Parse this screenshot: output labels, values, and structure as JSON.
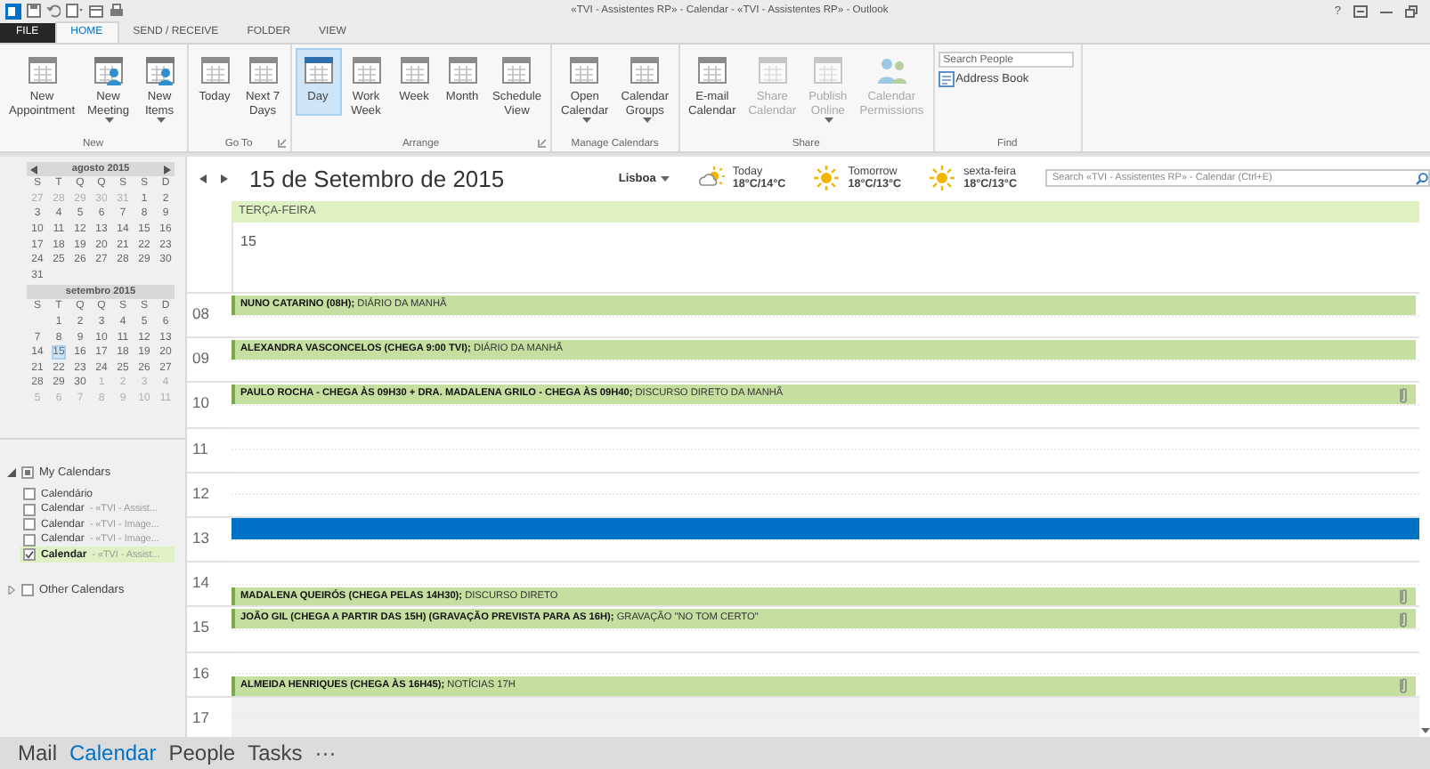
{
  "window": {
    "title": "«TVI - Assistentes RP» - Calendar - «TVI - Assistentes RP» - Outlook",
    "help": "?"
  },
  "ribbon_tabs": [
    {
      "label": "FILE",
      "kind": "file",
      "selected": false
    },
    {
      "label": "HOME",
      "kind": "tab",
      "selected": true
    },
    {
      "label": "SEND / RECEIVE",
      "kind": "tab",
      "selected": false
    },
    {
      "label": "FOLDER",
      "kind": "tab",
      "selected": false
    },
    {
      "label": "VIEW",
      "kind": "tab",
      "selected": false
    }
  ],
  "ribbon_groups": [
    {
      "label": "New",
      "kind": "buttons",
      "launcher": false,
      "buttons": [
        {
          "lines": [
            "New",
            "Appointment"
          ],
          "dropdown": false,
          "disabled": false,
          "selected": false
        },
        {
          "lines": [
            "New",
            "Meeting"
          ],
          "dropdown": true,
          "disabled": false,
          "selected": false
        },
        {
          "lines": [
            "New",
            "Items"
          ],
          "dropdown": true,
          "disabled": false,
          "selected": false
        }
      ]
    },
    {
      "label": "Go To",
      "kind": "buttons",
      "launcher": true,
      "buttons": [
        {
          "lines": [
            "Today"
          ],
          "dropdown": false,
          "disabled": false,
          "selected": false
        },
        {
          "lines": [
            "Next 7",
            "Days"
          ],
          "dropdown": false,
          "disabled": false,
          "selected": false
        }
      ]
    },
    {
      "label": "Arrange",
      "kind": "buttons",
      "launcher": true,
      "buttons": [
        {
          "lines": [
            "Day"
          ],
          "dropdown": false,
          "disabled": false,
          "selected": true
        },
        {
          "lines": [
            "Work",
            "Week"
          ],
          "dropdown": false,
          "disabled": false,
          "selected": false
        },
        {
          "lines": [
            "Week"
          ],
          "dropdown": false,
          "disabled": false,
          "selected": false
        },
        {
          "lines": [
            "Month"
          ],
          "dropdown": false,
          "disabled": false,
          "selected": false
        },
        {
          "lines": [
            "Schedule",
            "View"
          ],
          "dropdown": false,
          "disabled": false,
          "selected": false
        }
      ]
    },
    {
      "label": "Manage Calendars",
      "kind": "buttons",
      "launcher": false,
      "buttons": [
        {
          "lines": [
            "Open",
            "Calendar"
          ],
          "dropdown": true,
          "disabled": false,
          "selected": false
        },
        {
          "lines": [
            "Calendar",
            "Groups"
          ],
          "dropdown": true,
          "disabled": false,
          "selected": false
        }
      ]
    },
    {
      "label": "Share",
      "kind": "buttons",
      "launcher": false,
      "buttons": [
        {
          "lines": [
            "E-mail",
            "Calendar"
          ],
          "dropdown": false,
          "disabled": false,
          "selected": false
        },
        {
          "lines": [
            "Share",
            "Calendar"
          ],
          "dropdown": false,
          "disabled": true,
          "selected": false
        },
        {
          "lines": [
            "Publish",
            "Online"
          ],
          "dropdown": true,
          "disabled": true,
          "selected": false
        },
        {
          "lines": [
            "Calendar",
            "Permissions"
          ],
          "dropdown": false,
          "disabled": true,
          "selected": false
        }
      ]
    },
    {
      "label": "Find",
      "kind": "find",
      "launcher": false,
      "search_placeholder": "Search People",
      "address_book": "Address Book"
    }
  ],
  "mini_calendars": [
    {
      "month": "agosto 2015",
      "arrows": true,
      "weekdays": [
        "S",
        "T",
        "Q",
        "Q",
        "S",
        "S",
        "D"
      ],
      "weeks": [
        [
          {
            "day": "27",
            "other_month": true,
            "selected": false
          },
          {
            "day": "28",
            "other_month": true,
            "selected": false
          },
          {
            "day": "29",
            "other_month": true,
            "selected": false
          },
          {
            "day": "30",
            "other_month": true,
            "selected": false
          },
          {
            "day": "31",
            "other_month": true,
            "selected": false
          },
          {
            "day": "1",
            "other_month": false,
            "selected": false
          },
          {
            "day": "2",
            "other_month": false,
            "selected": false
          }
        ],
        [
          {
            "day": "3",
            "other_month": false,
            "selected": false
          },
          {
            "day": "4",
            "other_month": false,
            "selected": false
          },
          {
            "day": "5",
            "other_month": false,
            "selected": false
          },
          {
            "day": "6",
            "other_month": false,
            "selected": false
          },
          {
            "day": "7",
            "other_month": false,
            "selected": false
          },
          {
            "day": "8",
            "other_month": false,
            "selected": false
          },
          {
            "day": "9",
            "other_month": false,
            "selected": false
          }
        ],
        [
          {
            "day": "10",
            "other_month": false,
            "selected": false
          },
          {
            "day": "11",
            "other_month": false,
            "selected": false
          },
          {
            "day": "12",
            "other_month": false,
            "selected": false
          },
          {
            "day": "13",
            "other_month": false,
            "selected": false
          },
          {
            "day": "14",
            "other_month": false,
            "selected": false
          },
          {
            "day": "15",
            "other_month": false,
            "selected": false
          },
          {
            "day": "16",
            "other_month": false,
            "selected": false
          }
        ],
        [
          {
            "day": "17",
            "other_month": false,
            "selected": false
          },
          {
            "day": "18",
            "other_month": false,
            "selected": false
          },
          {
            "day": "19",
            "other_month": false,
            "selected": false
          },
          {
            "day": "20",
            "other_month": false,
            "selected": false
          },
          {
            "day": "21",
            "other_month": false,
            "selected": false
          },
          {
            "day": "22",
            "other_month": false,
            "selected": false
          },
          {
            "day": "23",
            "other_month": false,
            "selected": false
          }
        ],
        [
          {
            "day": "24",
            "other_month": false,
            "selected": false
          },
          {
            "day": "25",
            "other_month": false,
            "selected": false
          },
          {
            "day": "26",
            "other_month": false,
            "selected": false
          },
          {
            "day": "27",
            "other_month": false,
            "selected": false
          },
          {
            "day": "28",
            "other_month": false,
            "selected": false
          },
          {
            "day": "29",
            "other_month": false,
            "selected": false
          },
          {
            "day": "30",
            "other_month": false,
            "selected": false
          }
        ],
        [
          {
            "day": "31",
            "other_month": false,
            "selected": false
          }
        ]
      ]
    },
    {
      "month": "setembro 2015",
      "arrows": false,
      "weekdays": [
        "S",
        "T",
        "Q",
        "Q",
        "S",
        "S",
        "D"
      ],
      "weeks": [
        [
          {
            "day": "1",
            "other_month": false,
            "selected": false
          },
          {
            "day": "2",
            "other_month": false,
            "selected": false
          },
          {
            "day": "3",
            "other_month": false,
            "selected": false
          },
          {
            "day": "4",
            "other_month": false,
            "selected": false
          },
          {
            "day": "5",
            "other_month": false,
            "selected": false
          },
          {
            "day": "6",
            "other_month": false,
            "selected": false
          }
        ],
        [
          {
            "day": "7",
            "other_month": false,
            "selected": false
          },
          {
            "day": "8",
            "other_month": false,
            "selected": false
          },
          {
            "day": "9",
            "other_month": false,
            "selected": false
          },
          {
            "day": "10",
            "other_month": false,
            "selected": false
          },
          {
            "day": "11",
            "other_month": false,
            "selected": false
          },
          {
            "day": "12",
            "other_month": false,
            "selected": false
          },
          {
            "day": "13",
            "other_month": false,
            "selected": false
          }
        ],
        [
          {
            "day": "14",
            "other_month": false,
            "selected": false
          },
          {
            "day": "15",
            "other_month": false,
            "selected": true
          },
          {
            "day": "16",
            "other_month": false,
            "selected": false
          },
          {
            "day": "17",
            "other_month": false,
            "selected": false
          },
          {
            "day": "18",
            "other_month": false,
            "selected": false
          },
          {
            "day": "19",
            "other_month": false,
            "selected": false
          },
          {
            "day": "20",
            "other_month": false,
            "selected": false
          }
        ],
        [
          {
            "day": "21",
            "other_month": false,
            "selected": false
          },
          {
            "day": "22",
            "other_month": false,
            "selected": false
          },
          {
            "day": "23",
            "other_month": false,
            "selected": false
          },
          {
            "day": "24",
            "other_month": false,
            "selected": false
          },
          {
            "day": "25",
            "other_month": false,
            "selected": false
          },
          {
            "day": "26",
            "other_month": false,
            "selected": false
          },
          {
            "day": "27",
            "other_month": false,
            "selected": false
          }
        ],
        [
          {
            "day": "28",
            "other_month": false,
            "selected": false
          },
          {
            "day": "29",
            "other_month": false,
            "selected": false
          },
          {
            "day": "30",
            "other_month": false,
            "selected": false
          },
          {
            "day": "1",
            "other_month": true,
            "selected": false
          },
          {
            "day": "2",
            "other_month": true,
            "selected": false
          },
          {
            "day": "3",
            "other_month": true,
            "selected": false
          },
          {
            "day": "4",
            "other_month": true,
            "selected": false
          }
        ],
        [
          {
            "day": "5",
            "other_month": true,
            "selected": false
          },
          {
            "day": "6",
            "other_month": true,
            "selected": false
          },
          {
            "day": "7",
            "other_month": true,
            "selected": false
          },
          {
            "day": "8",
            "other_month": true,
            "selected": false
          },
          {
            "day": "9",
            "other_month": true,
            "selected": false
          },
          {
            "day": "10",
            "other_month": true,
            "selected": false
          },
          {
            "day": "11",
            "other_month": true,
            "selected": false
          }
        ]
      ]
    }
  ],
  "calendar_groups": [
    {
      "label": "My Calendars",
      "expanded": true,
      "checked": true,
      "items": [
        {
          "name": "Calendário",
          "checked": false,
          "selected": false
        },
        {
          "name": "Calendar",
          "owner": "- «TVI - Assist...",
          "checked": false,
          "selected": false
        },
        {
          "name": "Calendar",
          "owner": "- «TVI - Image...",
          "checked": false,
          "selected": false
        },
        {
          "name": "Calendar",
          "owner": "- «TVI - Image...",
          "checked": false,
          "selected": false
        },
        {
          "name": "Calendar",
          "owner": "- «TVI - Assist...",
          "checked": true,
          "selected": true
        }
      ]
    },
    {
      "label": "Other Calendars",
      "expanded": false,
      "checked": false
    }
  ],
  "day_view": {
    "date_title": "15 de Setembro de 2015",
    "location": "Lisboa",
    "weather": [
      {
        "day": "Today",
        "temps": "18°C/14°C",
        "kind": "partly-cloudy"
      },
      {
        "day": "Tomorrow",
        "temps": "18°C/13°C",
        "kind": "sunny"
      },
      {
        "day": "sexta-feira",
        "temps": "18°C/13°C",
        "kind": "sunny"
      }
    ],
    "search_placeholder": "Search «TVI - Assistentes RP» - Calendar (Ctrl+E)",
    "day_header": "TERÇA-FEIRA",
    "day_number": "15",
    "hours": [
      {
        "label": "08",
        "working": true,
        "slots": [
          {
            "selected": false,
            "event": {
              "text": "**NUNO CATARINO (08H);** DIÁRIO DA MANHÃ",
              "attachment": false
            }
          },
          {
            "selected": false
          }
        ]
      },
      {
        "label": "09",
        "working": true,
        "slots": [
          {
            "selected": false,
            "event": {
              "text": "**ALEXANDRA VASCONCELOS (CHEGA 9:00 TVI);** DIÁRIO DA MANHÃ",
              "attachment": false
            }
          },
          {
            "selected": false
          }
        ]
      },
      {
        "label": "10",
        "working": true,
        "slots": [
          {
            "selected": false,
            "event": {
              "text": "**PAULO ROCHA - CHEGA ÀS 09H30 + DRA. MADALENA GRILO - CHEGA ÀS 09H40;** DISCURSO DIRETO DA MANHÃ",
              "attachment": true
            }
          },
          {
            "selected": false
          }
        ]
      },
      {
        "label": "11",
        "working": true,
        "slots": [
          {
            "selected": false
          },
          {
            "selected": false
          }
        ]
      },
      {
        "label": "12",
        "working": true,
        "slots": [
          {
            "selected": false
          },
          {
            "selected": false
          }
        ]
      },
      {
        "label": "13",
        "working": true,
        "slots": [
          {
            "selected": true
          },
          {
            "selected": false
          }
        ]
      },
      {
        "label": "14",
        "working": true,
        "slots": [
          {
            "selected": false
          },
          {
            "selected": false,
            "event": {
              "text": "**MADALENA QUEIRÓS (CHEGA PELAS 14H30);** DISCURSO DIRETO",
              "attachment": true
            }
          }
        ]
      },
      {
        "label": "15",
        "working": true,
        "slots": [
          {
            "selected": false,
            "event": {
              "text": "**JOÃO GIL (CHEGA A PARTIR DAS 15H) (GRAVAÇÃO PREVISTA PARA AS 16H);** GRAVAÇÃO \"NO TOM CERTO\"",
              "attachment": true
            }
          },
          {
            "selected": false
          }
        ]
      },
      {
        "label": "16",
        "working": true,
        "slots": [
          {
            "selected": false
          },
          {
            "selected": false,
            "event": {
              "text": "**ALMEIDA HENRIQUES (CHEGA ÀS 16H45);** NOTÍCIAS 17H",
              "attachment": true
            }
          }
        ]
      },
      {
        "label": "17",
        "working": false,
        "slots": [
          {
            "selected": false
          },
          {
            "selected": false
          }
        ]
      }
    ]
  },
  "bottom_nav": [
    {
      "label": "Mail",
      "selected": false
    },
    {
      "label": "Calendar",
      "selected": true
    },
    {
      "label": "People",
      "selected": false
    },
    {
      "label": "Tasks",
      "selected": false
    },
    {
      "label": "···",
      "selected": false
    }
  ]
}
